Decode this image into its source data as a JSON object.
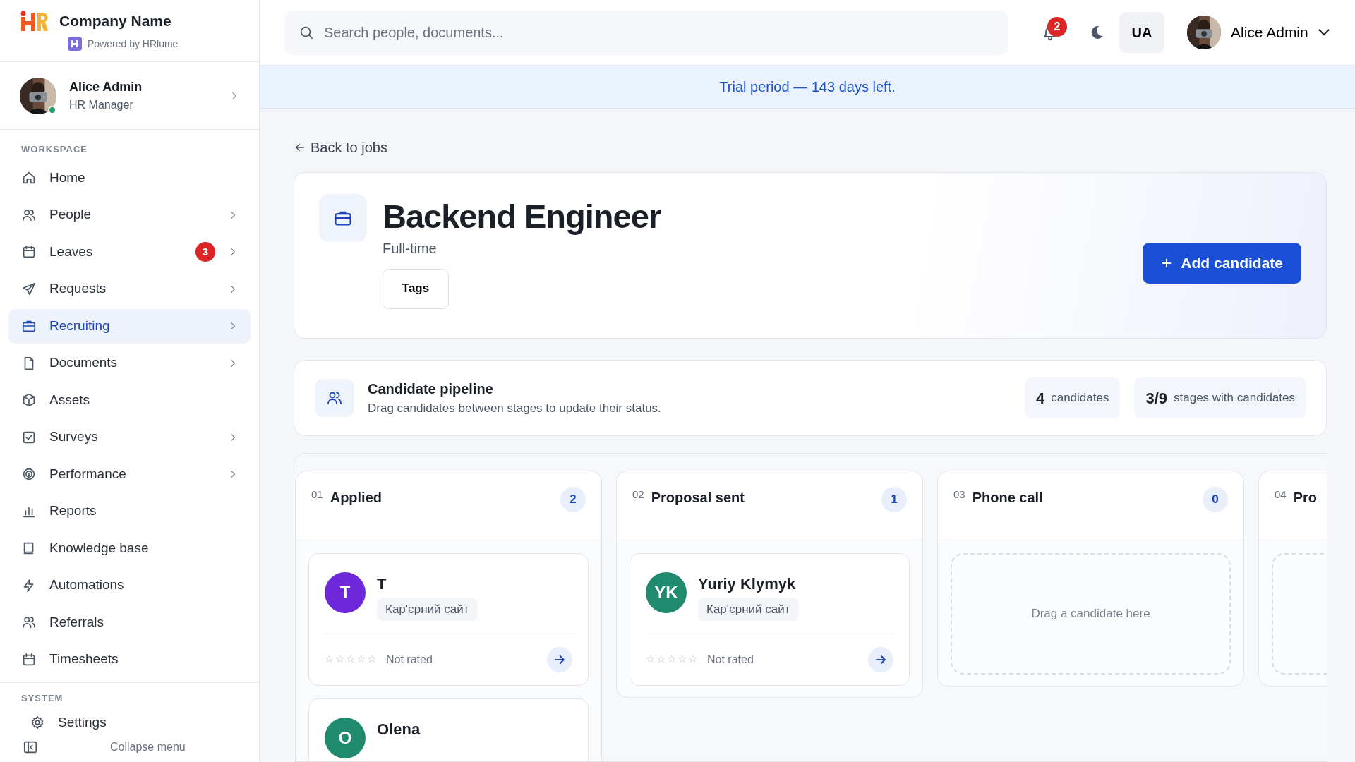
{
  "brand": {
    "name": "Company Name",
    "powered_by": "Powered by HRlume"
  },
  "user": {
    "name": "Alice Admin",
    "role": "HR Manager",
    "online": true
  },
  "sidebar": {
    "sections": [
      {
        "title": "WORKSPACE",
        "items": [
          {
            "label": "Home",
            "expandable": false,
            "selected": false
          },
          {
            "label": "People",
            "expandable": true,
            "selected": false
          },
          {
            "label": "Leaves",
            "badge": "3",
            "expandable": true,
            "selected": false
          },
          {
            "label": "Requests",
            "expandable": true,
            "selected": false
          },
          {
            "label": "Recruiting",
            "expandable": true,
            "selected": true
          },
          {
            "label": "Documents",
            "expandable": true,
            "selected": false
          },
          {
            "label": "Assets",
            "expandable": false,
            "selected": false
          },
          {
            "label": "Surveys",
            "expandable": true,
            "selected": false
          },
          {
            "label": "Performance",
            "expandable": true,
            "selected": false
          },
          {
            "label": "Reports",
            "expandable": false,
            "selected": false
          },
          {
            "label": "Knowledge base",
            "expandable": false,
            "selected": false
          },
          {
            "label": "Automations",
            "expandable": false,
            "selected": false
          },
          {
            "label": "Referrals",
            "expandable": false,
            "selected": false
          },
          {
            "label": "Timesheets",
            "expandable": false,
            "selected": false
          }
        ]
      },
      {
        "title": "SYSTEM",
        "items": [
          {
            "label": "Settings",
            "expandable": false,
            "selected": false
          }
        ]
      }
    ],
    "collapse": "Collapse menu"
  },
  "header": {
    "search": {
      "placeholder": "Search people, documents..."
    },
    "notifications": "2",
    "language": "UA",
    "user_name": "Alice Admin"
  },
  "banner": "Trial period — 143 days left.",
  "back_link": "Back to jobs",
  "job": {
    "title": "Backend Engineer",
    "type": "Full-time",
    "tags_button": "Tags",
    "add_button": "Add candidate"
  },
  "pipeline": {
    "title": "Candidate pipeline",
    "subtitle": "Drag candidates between stages to update their status.",
    "stats": [
      {
        "value": "4",
        "label": "candidates"
      },
      {
        "value": "3/9",
        "label": "stages with candidates"
      }
    ]
  },
  "stages": [
    {
      "number": "01",
      "name": "Applied",
      "count": "2",
      "candidates": [
        {
          "initials": "T",
          "name": "T",
          "source": "Кар'єрний сайт",
          "color": "#6d28d9",
          "stars": 0,
          "rating": "Not rated"
        },
        {
          "initials": "O",
          "name": "Olena",
          "color": "#1f8a6e"
        }
      ]
    },
    {
      "number": "02",
      "name": "Proposal sent",
      "count": "1",
      "candidates": [
        {
          "initials": "YK",
          "name": "Yuriy Klymyk",
          "source": "Кар'єрний сайт",
          "color": "#1f8a6e",
          "stars": 0,
          "rating": "Not rated"
        }
      ]
    },
    {
      "number": "03",
      "name": "Phone call",
      "count": "0",
      "empty_text": "Drag a candidate here"
    },
    {
      "number": "04",
      "name": "Pro"
    }
  ]
}
